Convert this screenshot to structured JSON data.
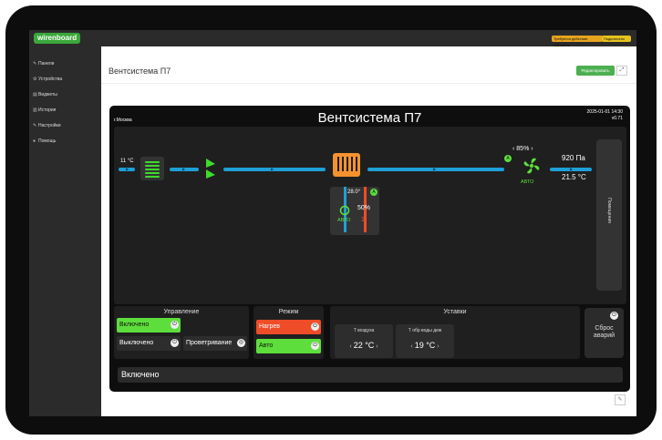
{
  "header": {
    "logo": "wirenboard",
    "badges": [
      "Требуется действие: Обновить",
      "Подключено"
    ]
  },
  "sidebar": {
    "items": [
      {
        "label": "Панели",
        "icon": "wrench-icon"
      },
      {
        "label": "Устройства",
        "icon": "gear-icon"
      },
      {
        "label": "Виджеты",
        "icon": "widget-icon"
      },
      {
        "label": "История",
        "icon": "chart-icon"
      },
      {
        "label": "Настройки",
        "icon": "wrench-icon"
      },
      {
        "label": "Помощь",
        "icon": "help-icon"
      }
    ]
  },
  "page": {
    "title": "Вентсистема П7",
    "edit_label": "Редактировать"
  },
  "widget": {
    "title": "Вентсистема П7",
    "city": "г.Москва",
    "date": "2025-01-01 14:30",
    "version": "v0.71",
    "scheme": {
      "outdoor_temp": "11 °C",
      "heater_temp": "28.0°",
      "valve_percent": "50%",
      "valve_mode": "АВТО",
      "valve_badge": "A",
      "fan_speed": "85%",
      "fan_badge": "A",
      "fan_mode": "АВТО",
      "pressure": "920 Па",
      "supply_temp": "21.5 °C",
      "room_label": "Помещения"
    },
    "control": {
      "title": "Управление",
      "on_label": "Включено",
      "off_label": "Выключено",
      "vent_label": "Проветривание"
    },
    "mode": {
      "title": "Режим",
      "heat_label": "Нагрев",
      "auto_label": "Авто"
    },
    "setpoints": {
      "title": "Уставки",
      "air_title": "Т воздуха",
      "air_value": "22 °C",
      "water_title": "Т обр воды деж",
      "water_value": "19 °C"
    },
    "reset_label": "Сброс аварий",
    "status_text": "Включено"
  },
  "colors": {
    "accent_green": "#5dde3c",
    "duct_blue": "#1e9fd8",
    "heater_orange": "#f5922f",
    "alarm_red": "#ef4c28"
  }
}
